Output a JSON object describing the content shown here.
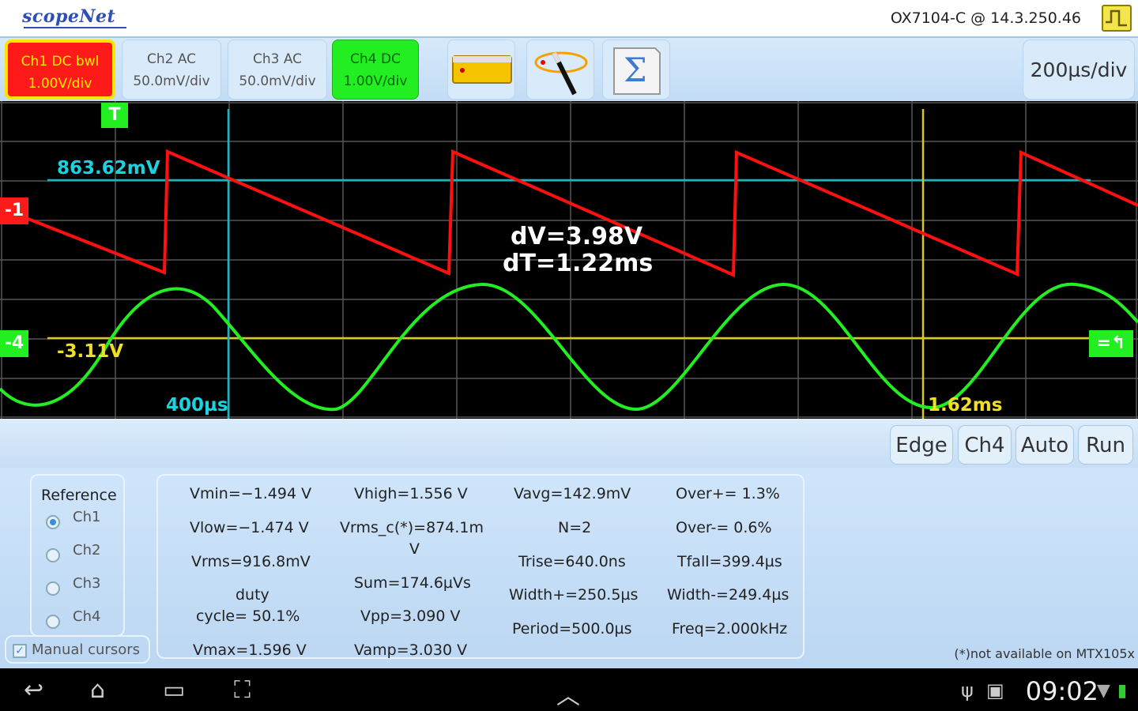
{
  "app": {
    "logo": "scopeNet",
    "device": "OX7104-C @ 14.3.250.46",
    "scope_icon": "oscilloscope-icon"
  },
  "toolbar": {
    "channels": [
      {
        "line1": "Ch1  DC bwl",
        "line2": "1.00V/div",
        "color": "#ff1a1a"
      },
      {
        "line1": "Ch2  AC",
        "line2": "50.0mV/div",
        "color": "#d9ebfb"
      },
      {
        "line1": "Ch3  AC",
        "line2": "50.0mV/div",
        "color": "#d9ebfb"
      },
      {
        "line1": "Ch4  DC",
        "line2": "1.00V/div",
        "color": "#22ee22"
      }
    ],
    "tools": [
      "ruler-icon",
      "magic-wand-icon",
      "sigma-math-icon"
    ],
    "timebase": "200µs/div"
  },
  "screen": {
    "hcursor1_label": "863.62mV",
    "hcursor2_label": "-3.11V",
    "vcursor1_label": "400µs",
    "vcursor2_label": "1.62ms",
    "dv": "dV=3.98V",
    "dt": "dT=1.22ms",
    "ch1_marker": "-1",
    "ch4_marker": "-4",
    "trigger_marker": "T",
    "trigger_level_marker": "=↰"
  },
  "trigger": {
    "type": "Edge",
    "source": "Ch4",
    "mode": "Auto",
    "state": "Run"
  },
  "reference": {
    "title": "Reference",
    "options": [
      "Ch1",
      "Ch2",
      "Ch3",
      "Ch4"
    ],
    "selected": "Ch1",
    "manual_cursors": "Manual cursors"
  },
  "measurements": {
    "vmin": "Vmin=−1.494  V",
    "vlow": "Vlow=−1.474  V",
    "vrms": "Vrms=916.8mV",
    "duty_a": "duty",
    "duty_b": "cycle=    50.1%",
    "vmax": "Vmax=1.596  V",
    "vhigh": "Vhigh=1.556  V",
    "vrmsc_a": "Vrms_c(*)=874.1m",
    "vrmsc_b": "V",
    "sum": "Sum=174.6µVs",
    "vpp": "Vpp=3.090  V",
    "vamp": "Vamp=3.030  V",
    "vavg": "Vavg=142.9mV",
    "n": "N=2",
    "trise": "Trise=640.0ns",
    "widthp": "Width+=250.5µs",
    "period": "Period=500.0µs",
    "overp": "Over+=     1.3%",
    "overm": "Over-=     0.6%",
    "tfall": "Tfall=399.4µs",
    "widthm": "Width-=249.4µs",
    "freq": "Freq=2.000kHz",
    "note": "(*)not available on MTX105x"
  },
  "navbar": {
    "back": "↩",
    "home": "⌂",
    "recent": "▭",
    "screenshot": "⛶",
    "up": "︿",
    "clock": "09:02"
  }
}
